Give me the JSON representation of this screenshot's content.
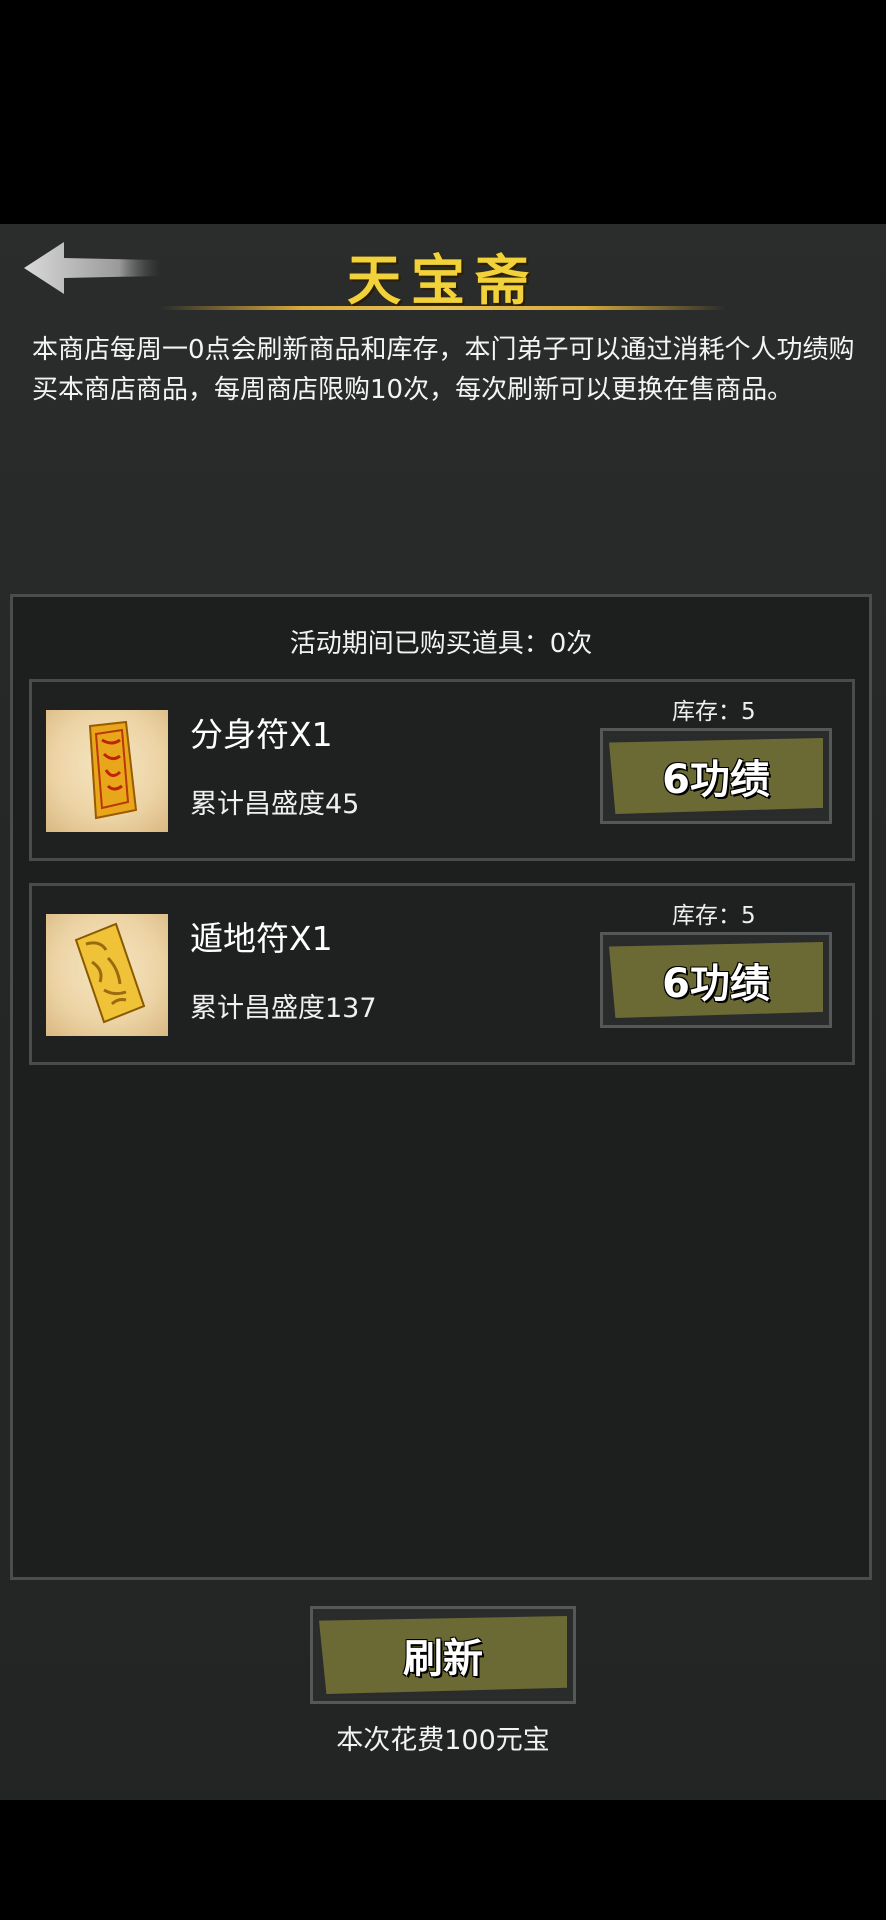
{
  "header": {
    "title": "天宝斋",
    "back_icon": "back-arrow-icon"
  },
  "description": "本商店每周一0点会刷新商品和库存，本门弟子可以通过消耗个人功绩购买本商店商品，每周商店限购10次，每次刷新可以更换在售商品。",
  "shop": {
    "purchased_label": "活动期间已购买道具：0次",
    "items": [
      {
        "name": "分身符X1",
        "sub": "累计昌盛度45",
        "stock": "库存：5",
        "price": "6功绩",
        "icon": "talisman-icon"
      },
      {
        "name": "遁地符X1",
        "sub": "累计昌盛度137",
        "stock": "库存：5",
        "price": "6功绩",
        "icon": "talisman-icon"
      }
    ]
  },
  "footer": {
    "refresh_label": "刷新",
    "cost_label": "本次花费100元宝"
  },
  "colors": {
    "title": "#f2d23a",
    "button": "#6b6a34",
    "panel": "#2b2d2d"
  }
}
